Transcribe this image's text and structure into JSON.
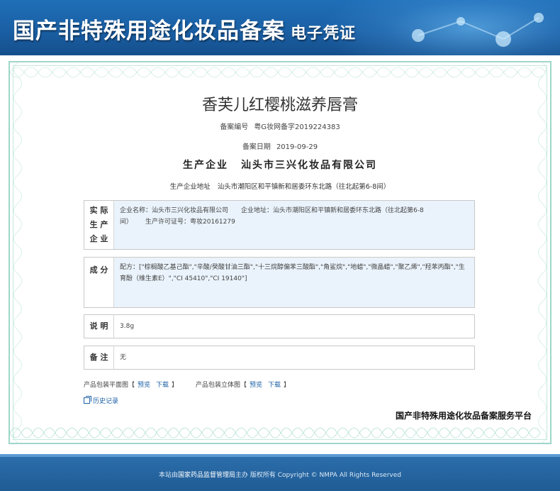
{
  "header": {
    "title": "国产非特殊用途化妆品备案",
    "subtitle": "电子凭证"
  },
  "product": {
    "name": "香芙儿红樱桃滋养唇膏",
    "record_number_label": "备案编号",
    "record_number": "粤G妆网备字2019224383",
    "record_date_label": "备案日期",
    "record_date": "2019-09-29",
    "enterprise_label": "生产企业",
    "enterprise": "汕头市三兴化妆品有限公司",
    "address_label": "生产企业地址",
    "address": "汕头市潮阳区和平镇新和居委环东北路（往北起第6-8间）"
  },
  "boxes": {
    "actual_producer": {
      "label": "实际生产企业",
      "label_lines": [
        "实 际",
        "生 产",
        "企 业"
      ],
      "line1_name_label": "企业名称：",
      "line1_name": "汕头市三兴化妆品有限公司",
      "line1_addr_label": "企业地址：",
      "line1_addr": "汕头市潮阳区和平镇新和居委环东北路（往北起第6-8",
      "line2_addr_cont": "间）",
      "line2_license_label": "生产许可证号：",
      "line2_license": "粤妆20161279"
    },
    "ingredients": {
      "label": "成 分",
      "prefix": "配方：",
      "text": "[\"棕榈酸乙基己酯\",\"辛酸/癸酸甘油三酯\",\"十三烷醇偏苯三酸酯\",\"角鲨烷\",\"地蜡\",\"微晶蜡\",\"聚乙烯\",\"羟苯丙酯\",\"生育酚（维生素E）\",\"CI 45410\",\"CI 19140\"]"
    },
    "description": {
      "label": "说 明",
      "value": "3.8g"
    },
    "remark": {
      "label": "备 注",
      "value": "无"
    }
  },
  "links": {
    "flat_label": "产品包装平面图【",
    "flat_preview": "预览",
    "flat_download": "下载",
    "flat_close": "】",
    "solid_label": "产品包装立体图【",
    "solid_preview": "预览",
    "solid_download": "下载",
    "solid_close": "】",
    "history": "历史记录"
  },
  "platform": "国产非特殊用途化妆品备案服务平台",
  "footer": {
    "prefix": "本站由",
    "org": "国家药品监督管理局",
    "suffix": "主办 版权所有 Copyright © NMPA All Rights Reserved"
  },
  "colors": {
    "banner": "#1a5fa4",
    "frame": "#9fd6c9",
    "link": "#1a5fa4",
    "box_shade": "#eaf3fb"
  }
}
